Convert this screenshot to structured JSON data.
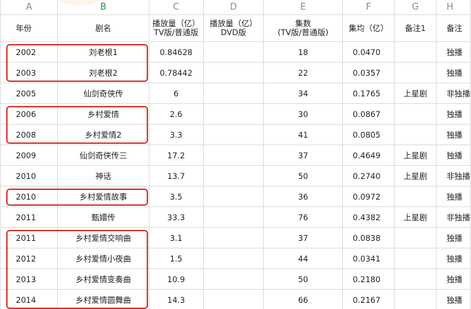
{
  "column_letters": [
    "A",
    "B",
    "C",
    "D",
    "E",
    "F",
    "G",
    "H"
  ],
  "active_column": "B",
  "headers": {
    "year": "年份",
    "title": "剧名",
    "plays_tv_l1": "播放量（亿）",
    "plays_tv_l2": "TV版/普通版",
    "plays_dvd_l1": "播放量（亿）",
    "plays_dvd_l2": "DVD版",
    "episodes_l1": "集数",
    "episodes_l2": "(TV版/普通版)",
    "per_episode": "集均（亿）",
    "note1": "备注1",
    "note2": "备注"
  },
  "rows": [
    {
      "year": "2002",
      "title": "刘老根1",
      "plays_tv": "0.84628",
      "plays_dvd": "",
      "episodes": "18",
      "per_episode": "0.0470",
      "note1": "",
      "note2": "独播",
      "highlighted": true
    },
    {
      "year": "2003",
      "title": "刘老根2",
      "plays_tv": "0.78442",
      "plays_dvd": "",
      "episodes": "22",
      "per_episode": "0.0357",
      "note1": "",
      "note2": "独播",
      "highlighted": true
    },
    {
      "year": "2005",
      "title": "仙剑奇侠传",
      "plays_tv": "6",
      "plays_dvd": "",
      "episodes": "34",
      "per_episode": "0.1765",
      "note1": "上星剧",
      "note2": "非独播",
      "highlighted": false
    },
    {
      "year": "2006",
      "title": "乡村爱情",
      "plays_tv": "2.6",
      "plays_dvd": "",
      "episodes": "30",
      "per_episode": "0.0867",
      "note1": "",
      "note2": "独播",
      "highlighted": true
    },
    {
      "year": "2008",
      "title": "乡村爱情2",
      "plays_tv": "3.3",
      "plays_dvd": "",
      "episodes": "41",
      "per_episode": "0.0805",
      "note1": "",
      "note2": "独播",
      "highlighted": true
    },
    {
      "year": "2009",
      "title": "仙剑奇侠传三",
      "plays_tv": "17.2",
      "plays_dvd": "",
      "episodes": "37",
      "per_episode": "0.4649",
      "note1": "上星剧",
      "note2": "独播",
      "highlighted": false
    },
    {
      "year": "2010",
      "title": "神话",
      "plays_tv": "13.7",
      "plays_dvd": "",
      "episodes": "50",
      "per_episode": "0.2740",
      "note1": "上星剧",
      "note2": "非独播",
      "highlighted": false
    },
    {
      "year": "2010",
      "title": "乡村爱情故事",
      "plays_tv": "3.5",
      "plays_dvd": "",
      "episodes": "36",
      "per_episode": "0.0972",
      "note1": "",
      "note2": "独播",
      "highlighted": true
    },
    {
      "year": "2011",
      "title": "甄嬛传",
      "plays_tv": "33.3",
      "plays_dvd": "",
      "episodes": "76",
      "per_episode": "0.4382",
      "note1": "上星剧",
      "note2": "非独播",
      "highlighted": false
    },
    {
      "year": "2011",
      "title": "乡村爱情交响曲",
      "plays_tv": "3.1",
      "plays_dvd": "",
      "episodes": "37",
      "per_episode": "0.0838",
      "note1": "",
      "note2": "独播",
      "highlighted": true
    },
    {
      "year": "2012",
      "title": "乡村爱情小夜曲",
      "plays_tv": "1.5",
      "plays_dvd": "",
      "episodes": "44",
      "per_episode": "0.0341",
      "note1": "",
      "note2": "独播",
      "highlighted": true
    },
    {
      "year": "2013",
      "title": "乡村爱情变奏曲",
      "plays_tv": "10.9",
      "plays_dvd": "",
      "episodes": "50",
      "per_episode": "0.2180",
      "note1": "",
      "note2": "独播",
      "highlighted": true
    },
    {
      "year": "2014",
      "title": "乡村爱情圆舞曲",
      "plays_tv": "14.3",
      "plays_dvd": "",
      "episodes": "66",
      "per_episode": "0.2167",
      "note1": "",
      "note2": "独播",
      "highlighted": true
    }
  ],
  "annotation_color": "#d9342b"
}
